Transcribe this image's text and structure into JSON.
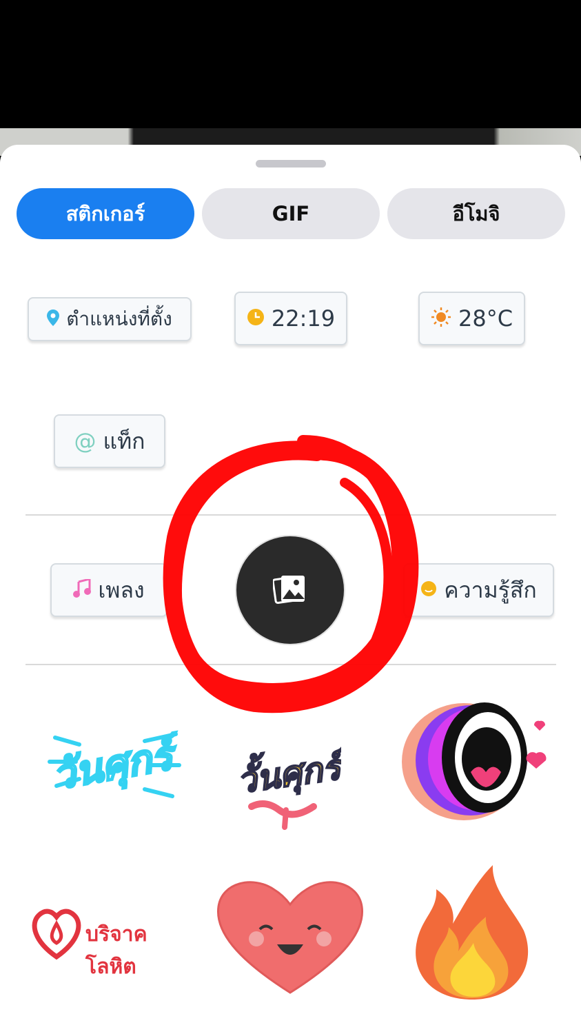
{
  "tabs": [
    {
      "label": "สติกเกอร์",
      "active": true
    },
    {
      "label": "GIF",
      "active": false
    },
    {
      "label": "อีโมจิ",
      "active": false
    }
  ],
  "chips": {
    "location": {
      "label": "ตำแหน่งที่ตั้ง",
      "icon": "location-pin-icon",
      "icon_color": "#3ab7e8"
    },
    "time": {
      "label": "22:19",
      "icon": "clock-icon",
      "icon_color": "#f5b417"
    },
    "weather": {
      "label": "28°C",
      "icon": "sun-icon",
      "icon_color": "#f08a24"
    },
    "tag": {
      "label": "แท็ก",
      "icon": "at-icon",
      "icon_color": "#7fd0c0"
    },
    "music": {
      "label": "เพลง",
      "icon": "music-note-icon",
      "icon_color": "#f06bb8"
    },
    "feeling": {
      "label": "ความรู้สึก",
      "icon": "smiley-icon",
      "icon_color": "#f5b417"
    }
  },
  "gallery_button": {
    "icon": "photo-gallery-icon"
  },
  "stickers": [
    {
      "name": "friday-neon-sticker",
      "text": "วันศุกร์",
      "color": "#35d2f2"
    },
    {
      "name": "friday-yellow-sticker",
      "text": "วั้นศุกร์",
      "color": "#f5c936"
    },
    {
      "name": "shouting-mouth-sticker"
    },
    {
      "name": "blood-donation-sticker",
      "text": "บริจาคโลหิต",
      "color": "#e2343f"
    },
    {
      "name": "smiling-heart-sticker"
    },
    {
      "name": "fire-sticker"
    }
  ],
  "colors": {
    "accent": "#1a7ff0",
    "annotation": "#ff0000"
  }
}
